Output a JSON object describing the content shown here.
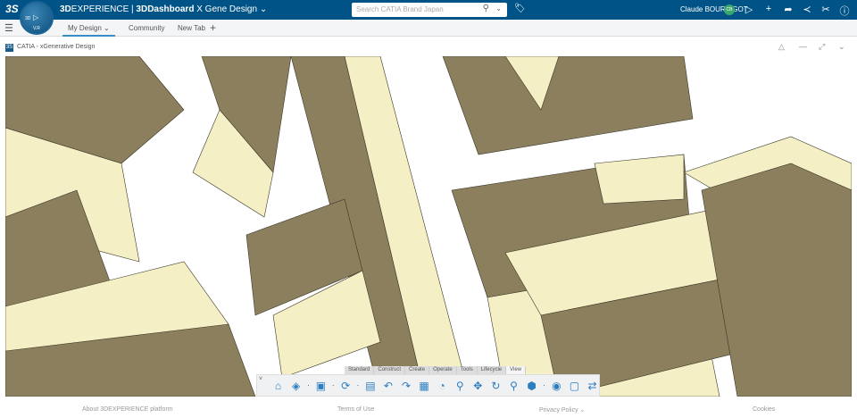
{
  "topbar": {
    "title_brand": "3D",
    "title_rest": "EXPERIENCE | ",
    "title_app": "3DDashboard",
    "dashboard_name": "X Gene Design",
    "search_placeholder": "Search CATIA Brand Japan",
    "user_name": "Claude BOURBIGOT",
    "user_initials": "CB",
    "compass_labels": [
      "3D",
      "V.R"
    ]
  },
  "tabs": [
    {
      "label": "My Design",
      "active": true
    },
    {
      "label": "Community"
    },
    {
      "label": "New Tab"
    }
  ],
  "widget": {
    "title": "CATIA - xGenerative Design"
  },
  "toolbar": {
    "tabs": [
      "Standard",
      "Construct",
      "Create",
      "Operate",
      "Tools",
      "Lifecycle",
      "View"
    ],
    "active_tab": "View",
    "icons": [
      "home-icon",
      "view-orientation-icon",
      "save-icon",
      "refresh-icon",
      "clipboard-icon",
      "undo-icon",
      "redo-icon",
      "diagram-icon",
      "rss-icon",
      "zoom-icon",
      "pan-icon",
      "rotate-icon",
      "zoom-area-icon",
      "render-style-icon",
      "settings-globe-icon",
      "monitor-settings-icon",
      "swap-view-icon"
    ]
  },
  "footer": {
    "about": "About 3DEXPERIENCE platform",
    "terms": "Terms of Use",
    "privacy": "Privacy Policy",
    "cookies": "Cookies"
  },
  "colors": {
    "topbar": "#005386",
    "building_dark": "#8b7f5e",
    "building_light": "#f5efc6",
    "accent": "#368ec4"
  }
}
